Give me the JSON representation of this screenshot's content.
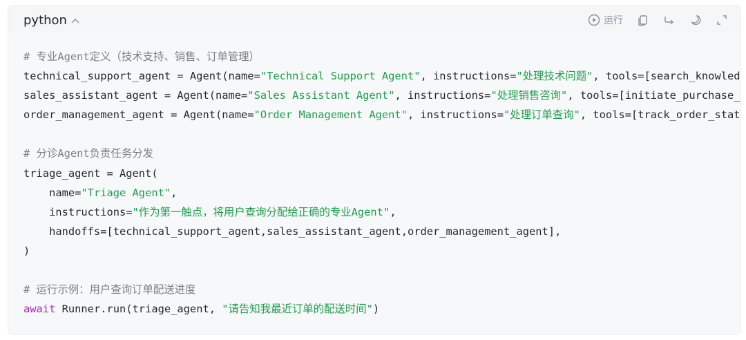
{
  "header": {
    "language": "python",
    "run_label": "运行"
  },
  "colors": {
    "comment": "#7b8089",
    "string": "#1e9e4a",
    "keyword": "#a626c7",
    "text": "#24292f"
  },
  "icons": {
    "collapse": "chevron-up-icon",
    "run": "play-circle-icon",
    "copy": "copy-icon",
    "wrap": "wrap-arrow-icon",
    "theme": "moon-icon",
    "expand": "expand-icon"
  },
  "code_lines": [
    [
      {
        "t": "comment",
        "v": "# 专业Agent定义（技术支持、销售、订单管理）"
      }
    ],
    [
      {
        "t": "text",
        "v": "technical_support_agent = Agent(name="
      },
      {
        "t": "string",
        "v": "\"Technical Support Agent\""
      },
      {
        "t": "text",
        "v": ", instructions="
      },
      {
        "t": "string",
        "v": "\"处理技术问题\""
      },
      {
        "t": "text",
        "v": ", tools=[search_knowledge_base])"
      }
    ],
    [
      {
        "t": "text",
        "v": "sales_assistant_agent = Agent(name="
      },
      {
        "t": "string",
        "v": "\"Sales Assistant Agent\""
      },
      {
        "t": "text",
        "v": ", instructions="
      },
      {
        "t": "string",
        "v": "\"处理销售咨询\""
      },
      {
        "t": "text",
        "v": ", tools=[initiate_purchase_order])"
      }
    ],
    [
      {
        "t": "text",
        "v": "order_management_agent = Agent(name="
      },
      {
        "t": "string",
        "v": "\"Order Management Agent\""
      },
      {
        "t": "text",
        "v": ", instructions="
      },
      {
        "t": "string",
        "v": "\"处理订单查询\""
      },
      {
        "t": "text",
        "v": ", tools=[track_order_status])"
      }
    ],
    [],
    [
      {
        "t": "comment",
        "v": "# 分诊Agent负责任务分发"
      }
    ],
    [
      {
        "t": "text",
        "v": "triage_agent = Agent("
      }
    ],
    [
      {
        "t": "text",
        "v": "    name="
      },
      {
        "t": "string",
        "v": "\"Triage Agent\""
      },
      {
        "t": "text",
        "v": ","
      }
    ],
    [
      {
        "t": "text",
        "v": "    instructions="
      },
      {
        "t": "string",
        "v": "\"作为第一触点，将用户查询分配给正确的专业Agent\""
      },
      {
        "t": "text",
        "v": ","
      }
    ],
    [
      {
        "t": "text",
        "v": "    handoffs=[technical_support_agent,sales_assistant_agent,order_management_agent],"
      }
    ],
    [
      {
        "t": "text",
        "v": ")"
      }
    ],
    [],
    [
      {
        "t": "comment",
        "v": "# 运行示例：用户查询订单配送进度"
      }
    ],
    [
      {
        "t": "keyword",
        "v": "await"
      },
      {
        "t": "text",
        "v": " Runner.run(triage_agent, "
      },
      {
        "t": "string",
        "v": "\"请告知我最近订单的配送时间\""
      },
      {
        "t": "text",
        "v": ")"
      }
    ]
  ]
}
